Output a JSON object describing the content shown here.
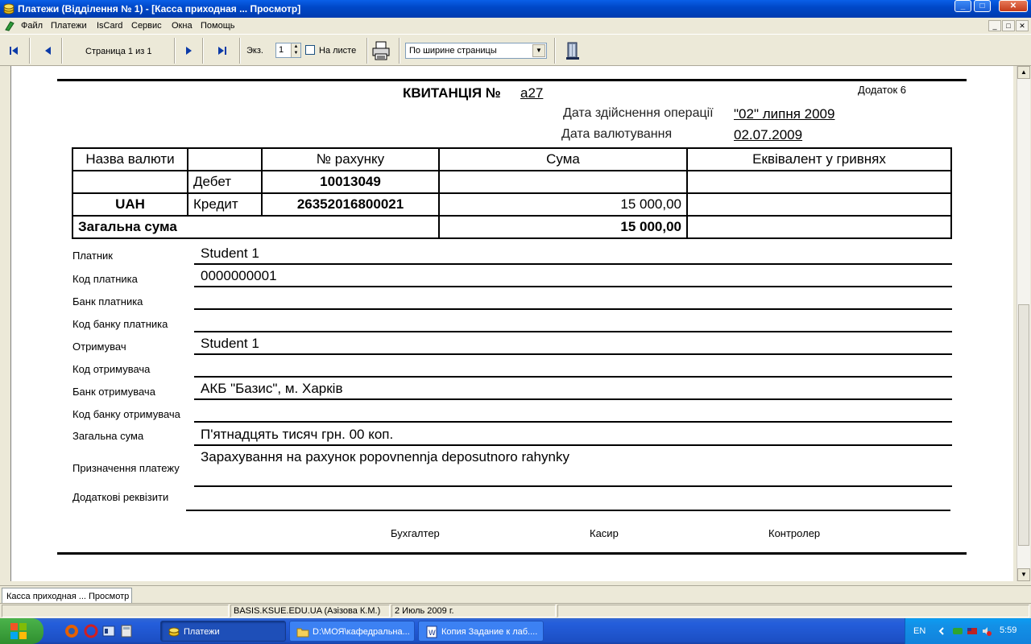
{
  "window": {
    "title": "Платежи (Відділення № 1) - [Касса приходная ... Просмотр]",
    "min_label": "_",
    "max_label": "□",
    "close_label": "✕"
  },
  "menu": {
    "items": [
      "Файл",
      "Платежи",
      "IsCard",
      "Сервис",
      "Окна",
      "Помощь"
    ]
  },
  "toolbar": {
    "page_label": "Страница 1 из 1",
    "copies_label": "Экз.",
    "copies_value": "1",
    "on_sheet_label": "На листе",
    "zoom_value": "По ширине страницы"
  },
  "receipt": {
    "title": "КВИТАНЦІЯ №",
    "number": "а27",
    "appendix": "Додаток 6",
    "op_date_label": "Дата здійснення операції",
    "op_date_value": "\"02\" липня 2009",
    "val_date_label": "Дата валютування",
    "val_date_value": "02.07.2009",
    "table": {
      "headers": [
        "Назва валюти",
        "",
        "№ рахунку",
        "Сума",
        "Еквівалент у гривнях"
      ],
      "debit_label": "Дебет",
      "debit_account": "10013049",
      "currency": "UAH",
      "credit_label": "Кредит",
      "credit_account": "26352016800021",
      "credit_sum": "15 000,00",
      "total_label": "Загальна сума",
      "total_sum": "15 000,00"
    },
    "fields": [
      {
        "label": "Платник",
        "value": "Student 1"
      },
      {
        "label": "Код платника",
        "value": "0000000001"
      },
      {
        "label": "Банк платника",
        "value": ""
      },
      {
        "label": "Код банку платника",
        "value": ""
      },
      {
        "label": "Отримувач",
        "value": "Student 1"
      },
      {
        "label": "Код отримувача",
        "value": ""
      },
      {
        "label": "Банк отримувача",
        "value": "АКБ \"Базис\", м. Харків"
      },
      {
        "label": "Код банку отримувача",
        "value": ""
      },
      {
        "label": "Загальна сума",
        "value": "П'ятнадцять тисяч грн. 00 коп."
      },
      {
        "label": "Призначення платежу",
        "value": "Зарахування на рахунок popovnennja deposutnoro rahynky"
      },
      {
        "label": "Додаткові реквізити",
        "value": ""
      }
    ],
    "signatures": [
      "Бухгалтер",
      "Касир",
      "Контролер"
    ]
  },
  "status": {
    "tab_label": "Касса приходная ... Просмотр",
    "server": "BASIS.KSUE.EDU.UA (Азізова К.М.)",
    "date": "2 Июль 2009 г."
  },
  "taskbar": {
    "tasks": [
      "Платежи",
      "D:\\МОЯ\\кафедральна...",
      "Копия Задание к лаб...."
    ],
    "lang": "EN",
    "clock": "5:59"
  },
  "colors": {
    "titlebar": "#0a5fe8",
    "taskbar": "#245edb",
    "tray": "#1390e6",
    "start": "#3c9a3c"
  }
}
